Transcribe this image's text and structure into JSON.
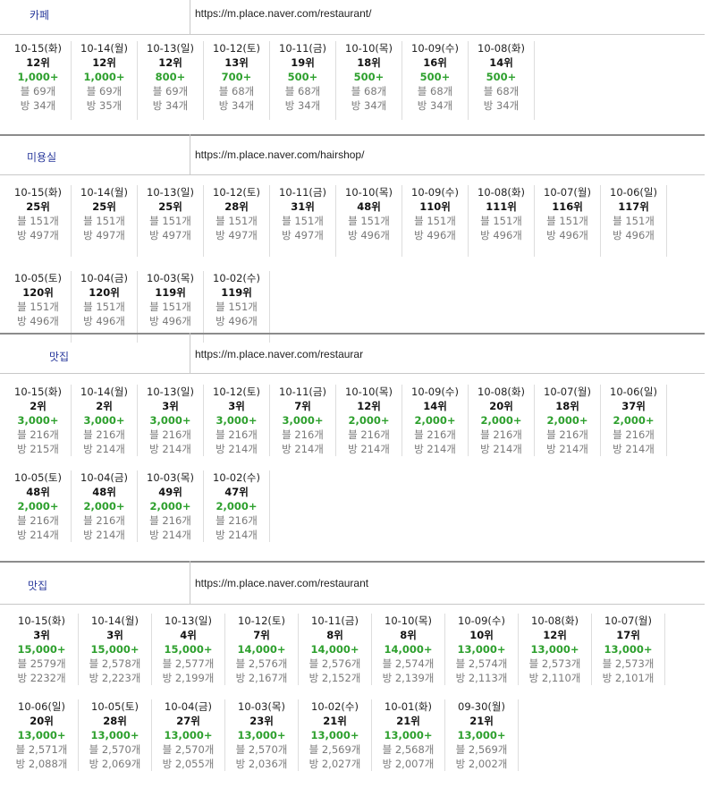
{
  "sections": [
    {
      "keyword": "카페",
      "url": "https://m.place.naver.com/restaurant/",
      "rows": [
        [
          {
            "date": "10-15(화)",
            "rank": "12위",
            "count": "1,000+",
            "blog": "블 69개",
            "visit": "방 34개"
          },
          {
            "date": "10-14(월)",
            "rank": "12위",
            "count": "1,000+",
            "blog": "블 69개",
            "visit": "방 35개"
          },
          {
            "date": "10-13(일)",
            "rank": "12위",
            "count": "800+",
            "blog": "블 69개",
            "visit": "방 34개"
          },
          {
            "date": "10-12(토)",
            "rank": "13위",
            "count": "700+",
            "blog": "블 68개",
            "visit": "방 34개"
          },
          {
            "date": "10-11(금)",
            "rank": "19위",
            "count": "500+",
            "blog": "블 68개",
            "visit": "방 34개"
          },
          {
            "date": "10-10(목)",
            "rank": "18위",
            "count": "500+",
            "blog": "블 68개",
            "visit": "방 34개"
          },
          {
            "date": "10-09(수)",
            "rank": "16위",
            "count": "500+",
            "blog": "블 68개",
            "visit": "방 34개"
          },
          {
            "date": "10-08(화)",
            "rank": "14위",
            "count": "500+",
            "blog": "블 68개",
            "visit": "방 34개"
          }
        ]
      ]
    },
    {
      "keyword": "미용실",
      "url": "https://m.place.naver.com/hairshop/",
      "rows": [
        [
          {
            "date": "10-15(화)",
            "rank": "25위",
            "blog": "블 151개",
            "visit": "방 497개"
          },
          {
            "date": "10-14(월)",
            "rank": "25위",
            "blog": "블 151개",
            "visit": "방 497개"
          },
          {
            "date": "10-13(일)",
            "rank": "25위",
            "blog": "블 151개",
            "visit": "방 497개"
          },
          {
            "date": "10-12(토)",
            "rank": "28위",
            "blog": "블 151개",
            "visit": "방 497개"
          },
          {
            "date": "10-11(금)",
            "rank": "31위",
            "blog": "블 151개",
            "visit": "방 497개"
          },
          {
            "date": "10-10(목)",
            "rank": "48위",
            "blog": "블 151개",
            "visit": "방 496개"
          },
          {
            "date": "10-09(수)",
            "rank": "110위",
            "blog": "블 151개",
            "visit": "방 496개"
          },
          {
            "date": "10-08(화)",
            "rank": "111위",
            "blog": "블 151개",
            "visit": "방 496개"
          },
          {
            "date": "10-07(월)",
            "rank": "116위",
            "blog": "블 151개",
            "visit": "방 496개"
          },
          {
            "date": "10-06(일)",
            "rank": "117위",
            "blog": "블 151개",
            "visit": "방 496개"
          }
        ],
        [
          {
            "date": "10-05(토)",
            "rank": "120위",
            "blog": "블 151개",
            "visit": "방 496개"
          },
          {
            "date": "10-04(금)",
            "rank": "120위",
            "blog": "블 151개",
            "visit": "방 496개"
          },
          {
            "date": "10-03(목)",
            "rank": "119위",
            "blog": "블 151개",
            "visit": "방 496개"
          },
          {
            "date": "10-02(수)",
            "rank": "119위",
            "blog": "블 151개",
            "visit": "방 496개"
          }
        ]
      ]
    },
    {
      "keyword": "맛집",
      "url": "https://m.place.naver.com/restaurar",
      "rows": [
        [
          {
            "date": "10-15(화)",
            "rank": "2위",
            "count": "3,000+",
            "blog": "블 216개",
            "visit": "방 215개"
          },
          {
            "date": "10-14(월)",
            "rank": "2위",
            "count": "3,000+",
            "blog": "블 216개",
            "visit": "방 214개"
          },
          {
            "date": "10-13(일)",
            "rank": "3위",
            "count": "3,000+",
            "blog": "블 216개",
            "visit": "방 214개"
          },
          {
            "date": "10-12(토)",
            "rank": "3위",
            "count": "3,000+",
            "blog": "블 216개",
            "visit": "방 214개"
          },
          {
            "date": "10-11(금)",
            "rank": "7위",
            "count": "3,000+",
            "blog": "블 216개",
            "visit": "방 214개"
          },
          {
            "date": "10-10(목)",
            "rank": "12위",
            "count": "2,000+",
            "blog": "블 216개",
            "visit": "방 214개"
          },
          {
            "date": "10-09(수)",
            "rank": "14위",
            "count": "2,000+",
            "blog": "블 216개",
            "visit": "방 214개"
          },
          {
            "date": "10-08(화)",
            "rank": "20위",
            "count": "2,000+",
            "blog": "블 216개",
            "visit": "방 214개"
          },
          {
            "date": "10-07(월)",
            "rank": "18위",
            "count": "2,000+",
            "blog": "블 216개",
            "visit": "방 214개"
          },
          {
            "date": "10-06(일)",
            "rank": "37위",
            "count": "2,000+",
            "blog": "블 216개",
            "visit": "방 214개"
          }
        ],
        [
          {
            "date": "10-05(토)",
            "rank": "48위",
            "count": "2,000+",
            "blog": "블 216개",
            "visit": "방 214개"
          },
          {
            "date": "10-04(금)",
            "rank": "48위",
            "count": "2,000+",
            "blog": "블 216개",
            "visit": "방 214개"
          },
          {
            "date": "10-03(목)",
            "rank": "49위",
            "count": "2,000+",
            "blog": "블 216개",
            "visit": "방 214개"
          },
          {
            "date": "10-02(수)",
            "rank": "47위",
            "count": "2,000+",
            "blog": "블 216개",
            "visit": "방 214개"
          }
        ]
      ]
    },
    {
      "keyword": "맛집",
      "url": "https://m.place.naver.com/restaurant",
      "rows": [
        [
          {
            "date": "10-15(화)",
            "rank": "3위",
            "count": "15,000+",
            "blog": "블 2579개",
            "visit": "방 2232개"
          },
          {
            "date": "10-14(월)",
            "rank": "3위",
            "count": "15,000+",
            "blog": "블 2,578개",
            "visit": "방 2,223개"
          },
          {
            "date": "10-13(일)",
            "rank": "4위",
            "count": "15,000+",
            "blog": "블 2,577개",
            "visit": "방 2,199개"
          },
          {
            "date": "10-12(토)",
            "rank": "7위",
            "count": "14,000+",
            "blog": "블 2,576개",
            "visit": "방 2,167개"
          },
          {
            "date": "10-11(금)",
            "rank": "8위",
            "count": "14,000+",
            "blog": "블 2,576개",
            "visit": "방 2,152개"
          },
          {
            "date": "10-10(목)",
            "rank": "8위",
            "count": "14,000+",
            "blog": "블 2,574개",
            "visit": "방 2,139개"
          },
          {
            "date": "10-09(수)",
            "rank": "10위",
            "count": "13,000+",
            "blog": "블 2,574개",
            "visit": "방 2,113개"
          },
          {
            "date": "10-08(화)",
            "rank": "12위",
            "count": "13,000+",
            "blog": "블 2,573개",
            "visit": "방 2,110개"
          },
          {
            "date": "10-07(월)",
            "rank": "17위",
            "count": "13,000+",
            "blog": "블 2,573개",
            "visit": "방 2,101개"
          }
        ],
        [
          {
            "date": "10-06(일)",
            "rank": "20위",
            "count": "13,000+",
            "blog": "블 2,571개",
            "visit": "방 2,088개"
          },
          {
            "date": "10-05(토)",
            "rank": "28위",
            "count": "13,000+",
            "blog": "블 2,570개",
            "visit": "방 2,069개"
          },
          {
            "date": "10-04(금)",
            "rank": "27위",
            "count": "13,000+",
            "blog": "블 2,570개",
            "visit": "방 2,055개"
          },
          {
            "date": "10-03(목)",
            "rank": "23위",
            "count": "13,000+",
            "blog": "블 2,570개",
            "visit": "방 2,036개"
          },
          {
            "date": "10-02(수)",
            "rank": "21위",
            "count": "13,000+",
            "blog": "블 2,569개",
            "visit": "방 2,027개"
          },
          {
            "date": "10-01(화)",
            "rank": "21위",
            "count": "13,000+",
            "blog": "블 2,568개",
            "visit": "방 2,007개"
          },
          {
            "date": "09-30(월)",
            "rank": "21위",
            "count": "13,000+",
            "blog": "블 2,569개",
            "visit": "방 2,002개"
          }
        ]
      ]
    }
  ]
}
